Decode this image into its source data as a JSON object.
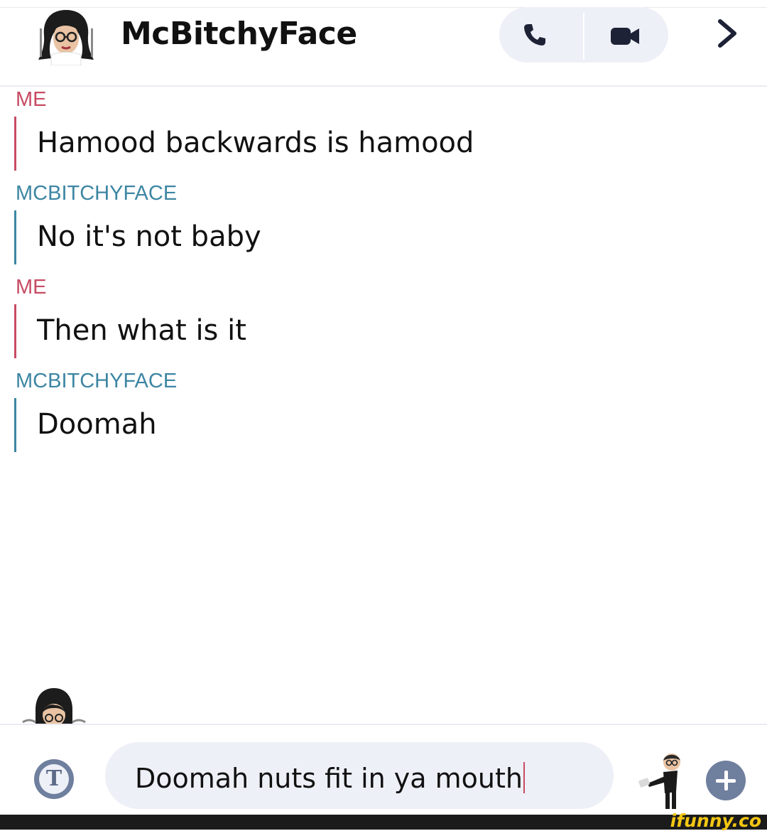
{
  "header": {
    "title": "McBitchyFace",
    "avatar_icon": "bitmoji-avatar-icon",
    "call_icon": "phone-icon",
    "video_icon": "video-camera-icon",
    "more_icon": "chevron-right-icon"
  },
  "messages": [
    {
      "sender": "ME",
      "text": "Hamood backwards is hamood",
      "role": "me"
    },
    {
      "sender": "MCBITCHYFACE",
      "text": "No it's not baby",
      "role": "them"
    },
    {
      "sender": "ME",
      "text": "Then what is it",
      "role": "me"
    },
    {
      "sender": "MCBITCHYFACE",
      "text": "Doomah",
      "role": "them"
    }
  ],
  "composer": {
    "text_mode_label": "T",
    "draft_text": "Doomah nuts fit in ya mouth",
    "bitmoji_icon": "bitmoji-sticker-icon",
    "add_icon": "plus-icon"
  },
  "watermark": {
    "text": "ifunny.co"
  },
  "colors": {
    "me": "#c74b63",
    "them": "#3d86a3",
    "pill": "#eef0f7",
    "button": "#6f7f9e",
    "watermark": "#f3c613"
  }
}
